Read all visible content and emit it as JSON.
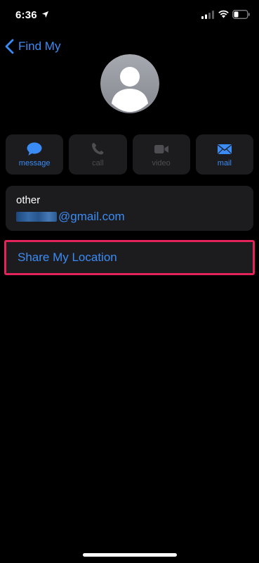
{
  "status_bar": {
    "time": "6:36",
    "icons": [
      "location-arrow-icon",
      "signal-icon",
      "wifi-icon",
      "battery-icon"
    ]
  },
  "nav": {
    "back_label": "Find My"
  },
  "contact": {
    "avatar_icon": "person-silhouette-icon"
  },
  "actions": [
    {
      "label": "message",
      "icon": "message-bubble-icon",
      "enabled": true
    },
    {
      "label": "call",
      "icon": "phone-icon",
      "enabled": false
    },
    {
      "label": "video",
      "icon": "video-camera-icon",
      "enabled": false
    },
    {
      "label": "mail",
      "icon": "envelope-icon",
      "enabled": true
    }
  ],
  "email": {
    "type_label": "other",
    "address_visible": "@gmail.com"
  },
  "share": {
    "label": "Share My Location",
    "highlighted": true
  },
  "colors": {
    "background": "#000000",
    "card": "#1c1c1e",
    "accent": "#3b8bf5",
    "disabled": "#4d4d52",
    "highlight": "#e2245a"
  }
}
